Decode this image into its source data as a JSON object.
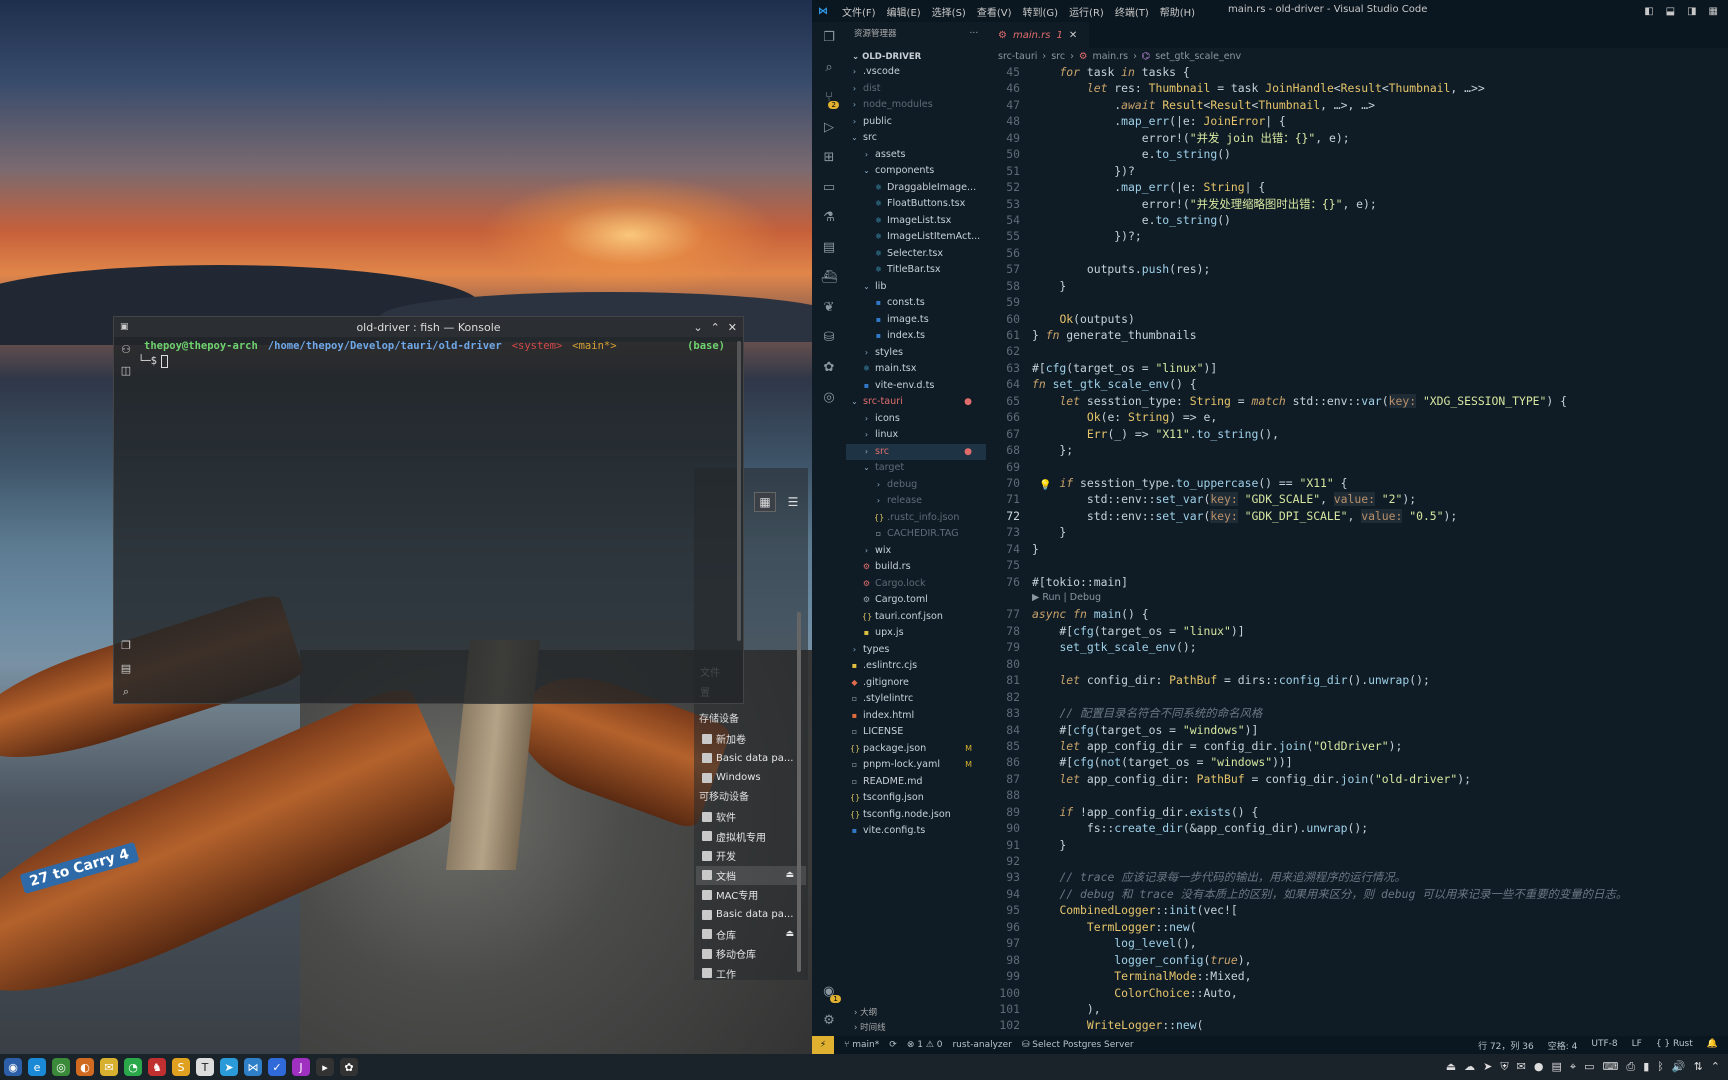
{
  "desktop": {
    "boat_label": "27 to Carry 4"
  },
  "konsole": {
    "title": "old-driver : fish — Konsole",
    "prompt_user": "thepoy@thepoy-arch",
    "prompt_path": "/home/thepoy/Develop/tauri/old-driver",
    "prompt_system": "<system>",
    "prompt_branch": "<main*>",
    "prompt_env": "(base)",
    "prompt_char": "└─$"
  },
  "file_manager": {
    "storage_header": "存储设备",
    "storage": [
      "新加卷",
      "Basic data pa...",
      "Windows"
    ],
    "removable_header": "可移动设备",
    "removable": [
      "软件",
      "虚拟机专用",
      "开发",
      "文档",
      "MAC专用",
      "Basic data pa...",
      "仓库",
      "移动仓库",
      "工作"
    ],
    "fragments": [
      "文件",
      "置"
    ]
  },
  "vscode": {
    "menu": [
      "文件(F)",
      "编辑(E)",
      "选择(S)",
      "查看(V)",
      "转到(G)",
      "运行(R)",
      "终端(T)",
      "帮助(H)"
    ],
    "window_title": "main.rs - old-driver - Visual Studio Code",
    "explorer_title": "资源管理器",
    "explorer_root": "OLD-DRIVER",
    "scm_badge": "2",
    "settings_badge": "1",
    "outline": "大纲",
    "timeline": "时间线",
    "tab_label": "main.rs",
    "tab_problems": "1",
    "breadcrumb": [
      "src-tauri",
      "src",
      "main.rs",
      "set_gtk_scale_env"
    ],
    "status": {
      "branch": "main*",
      "errors": "1",
      "warnings": "0",
      "analyzer": "rust-analyzer",
      "postgres": "Select Postgres Server",
      "position": "行 72，列 36",
      "spaces": "空格: 4",
      "encoding": "UTF-8",
      "eol": "LF",
      "language": "Rust"
    }
  },
  "files": [
    {
      "name": ".vscode",
      "depth": 1,
      "kind": "folder",
      "tone": "normal"
    },
    {
      "name": "dist",
      "depth": 1,
      "kind": "folder",
      "tone": "dim"
    },
    {
      "name": "node_modules",
      "depth": 1,
      "kind": "folder",
      "tone": "dim"
    },
    {
      "name": "public",
      "depth": 1,
      "kind": "folder",
      "tone": "normal"
    },
    {
      "name": "src",
      "depth": 1,
      "kind": "folder-open",
      "tone": "normal"
    },
    {
      "name": "assets",
      "depth": 2,
      "kind": "folder",
      "tone": "normal"
    },
    {
      "name": "components",
      "depth": 2,
      "kind": "folder-open",
      "tone": "normal"
    },
    {
      "name": "DraggableImage...",
      "depth": 3,
      "kind": "react",
      "tone": "normal"
    },
    {
      "name": "FloatButtons.tsx",
      "depth": 3,
      "kind": "react",
      "tone": "normal"
    },
    {
      "name": "ImageList.tsx",
      "depth": 3,
      "kind": "react",
      "tone": "normal"
    },
    {
      "name": "ImageListItemAct...",
      "depth": 3,
      "kind": "react",
      "tone": "normal"
    },
    {
      "name": "Selecter.tsx",
      "depth": 3,
      "kind": "react",
      "tone": "normal"
    },
    {
      "name": "TitleBar.tsx",
      "depth": 3,
      "kind": "react",
      "tone": "normal"
    },
    {
      "name": "lib",
      "depth": 2,
      "kind": "folder-open",
      "tone": "normal"
    },
    {
      "name": "const.ts",
      "depth": 3,
      "kind": "ts",
      "tone": "normal"
    },
    {
      "name": "image.ts",
      "depth": 3,
      "kind": "ts",
      "tone": "normal"
    },
    {
      "name": "index.ts",
      "depth": 3,
      "kind": "ts",
      "tone": "normal"
    },
    {
      "name": "styles",
      "depth": 2,
      "kind": "folder",
      "tone": "normal"
    },
    {
      "name": "main.tsx",
      "depth": 2,
      "kind": "react",
      "tone": "normal"
    },
    {
      "name": "vite-env.d.ts",
      "depth": 2,
      "kind": "ts",
      "tone": "normal"
    },
    {
      "name": "src-tauri",
      "depth": 1,
      "kind": "folder-open",
      "tone": "red",
      "dot": true
    },
    {
      "name": "icons",
      "depth": 2,
      "kind": "folder",
      "tone": "normal"
    },
    {
      "name": "linux",
      "depth": 2,
      "kind": "folder",
      "tone": "normal"
    },
    {
      "name": "src",
      "depth": 2,
      "kind": "folder",
      "tone": "red",
      "dot": true,
      "selected": true
    },
    {
      "name": "target",
      "depth": 2,
      "kind": "folder-open",
      "tone": "dim"
    },
    {
      "name": "debug",
      "depth": 3,
      "kind": "folder",
      "tone": "dim"
    },
    {
      "name": "release",
      "depth": 3,
      "kind": "folder",
      "tone": "dim"
    },
    {
      "name": ".rustc_info.json",
      "depth": 3,
      "kind": "json",
      "tone": "dim"
    },
    {
      "name": "CACHEDIR.TAG",
      "depth": 3,
      "kind": "file",
      "tone": "dim"
    },
    {
      "name": "wix",
      "depth": 2,
      "kind": "folder",
      "tone": "normal"
    },
    {
      "name": "build.rs",
      "depth": 2,
      "kind": "rust",
      "tone": "normal"
    },
    {
      "name": "Cargo.lock",
      "depth": 2,
      "kind": "rust",
      "tone": "dim"
    },
    {
      "name": "Cargo.toml",
      "depth": 2,
      "kind": "gear",
      "tone": "normal"
    },
    {
      "name": "tauri.conf.json",
      "depth": 2,
      "kind": "json",
      "tone": "normal"
    },
    {
      "name": "upx.js",
      "depth": 2,
      "kind": "js",
      "tone": "normal"
    },
    {
      "name": "types",
      "depth": 1,
      "kind": "folder",
      "tone": "normal"
    },
    {
      "name": ".eslintrc.cjs",
      "depth": 1,
      "kind": "js",
      "tone": "normal"
    },
    {
      "name": ".gitignore",
      "depth": 1,
      "kind": "git",
      "tone": "normal"
    },
    {
      "name": ".stylelintrc",
      "depth": 1,
      "kind": "file",
      "tone": "normal"
    },
    {
      "name": "index.html",
      "depth": 1,
      "kind": "html",
      "tone": "normal"
    },
    {
      "name": "LICENSE",
      "depth": 1,
      "kind": "file",
      "tone": "normal"
    },
    {
      "name": "package.json",
      "depth": 1,
      "kind": "json",
      "tone": "normal",
      "mark": "M"
    },
    {
      "name": "pnpm-lock.yaml",
      "depth": 1,
      "kind": "file",
      "tone": "normal",
      "mark": "M"
    },
    {
      "name": "README.md",
      "depth": 1,
      "kind": "file",
      "tone": "normal"
    },
    {
      "name": "tsconfig.json",
      "depth": 1,
      "kind": "json",
      "tone": "normal"
    },
    {
      "name": "tsconfig.node.json",
      "depth": 1,
      "kind": "json",
      "tone": "normal"
    },
    {
      "name": "vite.config.ts",
      "depth": 1,
      "kind": "ts",
      "tone": "normal"
    }
  ],
  "code": [
    {
      "n": "45",
      "t": "    for task in tasks {"
    },
    {
      "n": "46",
      "t": "        let res: Thumbnail = task JoinHandle<Result<Thumbnail, …>>"
    },
    {
      "n": "47",
      "t": "            .await Result<Result<Thumbnail, …>, …>"
    },
    {
      "n": "48",
      "t": "            .map_err(|e: JoinError| {"
    },
    {
      "n": "49",
      "t": "                error!(\"并发 join 出错：{}\", e);"
    },
    {
      "n": "50",
      "t": "                e.to_string()"
    },
    {
      "n": "51",
      "t": "            })?"
    },
    {
      "n": "52",
      "t": "            .map_err(|e: String| {"
    },
    {
      "n": "53",
      "t": "                error!(\"并发处理缩略图时出错：{}\", e);"
    },
    {
      "n": "54",
      "t": "                e.to_string()"
    },
    {
      "n": "55",
      "t": "            })?;"
    },
    {
      "n": "56",
      "t": ""
    },
    {
      "n": "57",
      "t": "        outputs.push(res);"
    },
    {
      "n": "58",
      "t": "    }"
    },
    {
      "n": "59",
      "t": ""
    },
    {
      "n": "60",
      "t": "    Ok(outputs)"
    },
    {
      "n": "61",
      "t": "} fn generate_thumbnails"
    },
    {
      "n": "62",
      "t": ""
    },
    {
      "n": "63",
      "t": "#[cfg(target_os = \"linux\")]"
    },
    {
      "n": "64",
      "t": "fn set_gtk_scale_env() {"
    },
    {
      "n": "65",
      "t": "    let sesstion_type: String = match std::env::var(key: \"XDG_SESSION_TYPE\") {"
    },
    {
      "n": "66",
      "t": "        Ok(e: String) => e,"
    },
    {
      "n": "67",
      "t": "        Err(_) => \"X11\".to_string(),"
    },
    {
      "n": "68",
      "t": "    };"
    },
    {
      "n": "69",
      "t": ""
    },
    {
      "n": "70",
      "t": "    if sesstion_type.to_uppercase() == \"X11\" {"
    },
    {
      "n": "71",
      "t": "        std::env::set_var(key: \"GDK_SCALE\", value: \"2\");"
    },
    {
      "n": "72",
      "t": "        std::env::set_var(key: \"GDK_DPI_SCALE\", value: \"0.5\");"
    },
    {
      "n": "73",
      "t": "    }"
    },
    {
      "n": "74",
      "t": "}"
    },
    {
      "n": "75",
      "t": ""
    },
    {
      "n": "76",
      "t": "#[tokio::main]"
    },
    {
      "n": "",
      "t": "▶ Run | Debug",
      "lens": true
    },
    {
      "n": "77",
      "t": "async fn main() {"
    },
    {
      "n": "78",
      "t": "    #[cfg(target_os = \"linux\")]"
    },
    {
      "n": "79",
      "t": "    set_gtk_scale_env();"
    },
    {
      "n": "80",
      "t": ""
    },
    {
      "n": "81",
      "t": "    let config_dir: PathBuf = dirs::config_dir().unwrap();"
    },
    {
      "n": "82",
      "t": ""
    },
    {
      "n": "83",
      "t": "    // 配置目录名符合不同系统的命名风格"
    },
    {
      "n": "84",
      "t": "    #[cfg(target_os = \"windows\")]"
    },
    {
      "n": "85",
      "t": "    let app_config_dir = config_dir.join(\"OldDriver\");"
    },
    {
      "n": "86",
      "t": "    #[cfg(not(target_os = \"windows\"))]"
    },
    {
      "n": "87",
      "t": "    let app_config_dir: PathBuf = config_dir.join(\"old-driver\");"
    },
    {
      "n": "88",
      "t": ""
    },
    {
      "n": "89",
      "t": "    if !app_config_dir.exists() {"
    },
    {
      "n": "90",
      "t": "        fs::create_dir(&app_config_dir).unwrap();"
    },
    {
      "n": "91",
      "t": "    }"
    },
    {
      "n": "92",
      "t": ""
    },
    {
      "n": "93",
      "t": "    // trace 应该记录每一步代码的输出，用来追溯程序的运行情况。"
    },
    {
      "n": "94",
      "t": "    // debug 和 trace 没有本质上的区别，如果用来区分，则 debug 可以用来记录一些不重要的变量的日志。"
    },
    {
      "n": "95",
      "t": "    CombinedLogger::init(vec!["
    },
    {
      "n": "96",
      "t": "        TermLogger::new("
    },
    {
      "n": "97",
      "t": "            log_level(),"
    },
    {
      "n": "98",
      "t": "            logger_config(true),"
    },
    {
      "n": "99",
      "t": "            TerminalMode::Mixed,"
    },
    {
      "n": "100",
      "t": "            ColorChoice::Auto,"
    },
    {
      "n": "101",
      "t": "        ),"
    },
    {
      "n": "102",
      "t": "        WriteLogger::new("
    }
  ],
  "colors": {
    "accent": "#2f9be8",
    "modified_red": "#e06c6c",
    "status_warning": "#e0b030",
    "keyword": "#c9a36b",
    "string": "#d6e6a0"
  }
}
